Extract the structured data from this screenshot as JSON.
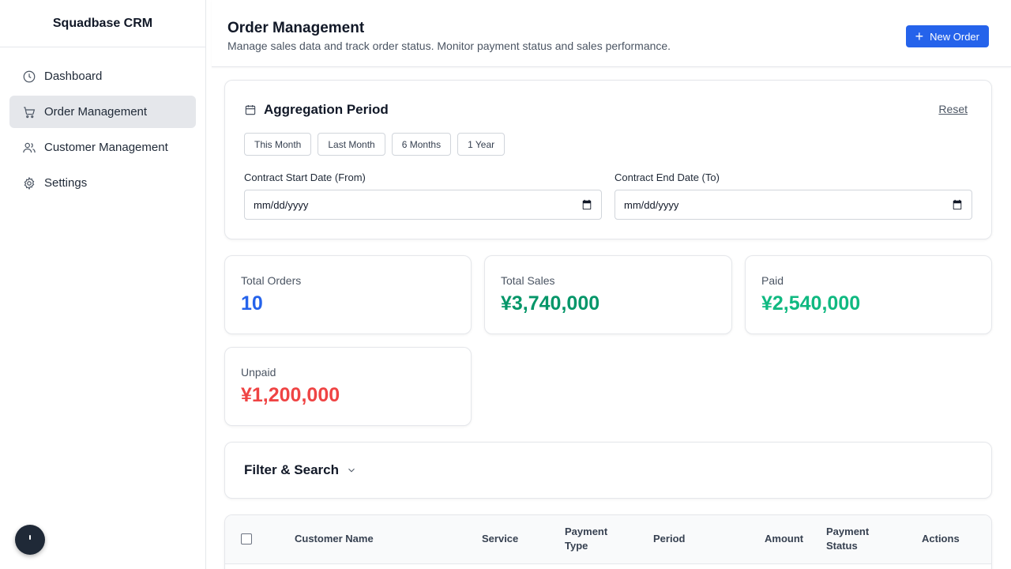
{
  "sidebar": {
    "brand": "Squadbase CRM",
    "items": [
      {
        "label": "Dashboard",
        "icon": "clock-icon",
        "active": false
      },
      {
        "label": "Order Management",
        "icon": "cart-icon",
        "active": true
      },
      {
        "label": "Customer Management",
        "icon": "users-icon",
        "active": false
      },
      {
        "label": "Settings",
        "icon": "gear-icon",
        "active": false
      }
    ]
  },
  "header": {
    "title": "Order Management",
    "subtitle": "Manage sales data and track order status. Monitor payment status and sales performance.",
    "new_order_label": "New Order"
  },
  "period": {
    "title": "Aggregation Period",
    "reset_label": "Reset",
    "presets": [
      "This Month",
      "Last Month",
      "6 Months",
      "1 Year"
    ],
    "start_label": "Contract Start Date (From)",
    "end_label": "Contract End Date (To)",
    "start_placeholder": "mm/dd/yyyy",
    "end_placeholder": "mm/dd/yyyy"
  },
  "stats": {
    "total_orders": {
      "label": "Total Orders",
      "value": "10",
      "color": "#2563eb"
    },
    "total_sales": {
      "label": "Total Sales",
      "value": "¥3,740,000",
      "color": "#059669"
    },
    "paid": {
      "label": "Paid",
      "value": "¥2,540,000",
      "color": "#10b981"
    },
    "unpaid": {
      "label": "Unpaid",
      "value": "¥1,200,000",
      "color": "#ef4444"
    }
  },
  "filter": {
    "title": "Filter & Search"
  },
  "table": {
    "columns": {
      "customer": "Customer Name",
      "service": "Service",
      "payment_type_1": "Payment",
      "payment_type_2": "Type",
      "period": "Period",
      "amount": "Amount",
      "payment_status_1": "Payment",
      "payment_status_2": "Status",
      "actions": "Actions"
    }
  },
  "theme": {
    "accent": "#2563eb",
    "active_nav_bg": "#e5e7eb"
  }
}
